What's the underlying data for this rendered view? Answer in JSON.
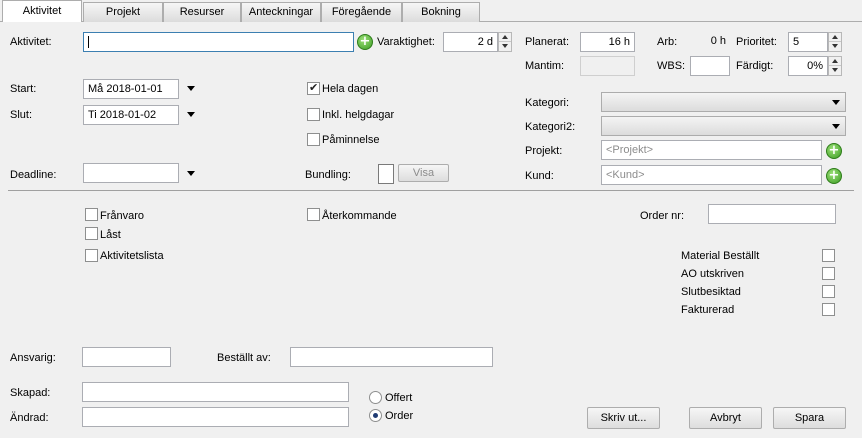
{
  "tabs": [
    "Aktivitet",
    "Projekt",
    "Resurser",
    "Anteckningar",
    "Föregående",
    "Bokning"
  ],
  "labels": {
    "aktivitet": "Aktivitet:",
    "varaktighet": "Varaktighet:",
    "planerat": "Planerat:",
    "arb": "Arb:",
    "prioritet": "Prioritet:",
    "mantim": "Mantim:",
    "wbs": "WBS:",
    "fardigt": "Färdigt:",
    "start": "Start:",
    "slut": "Slut:",
    "deadline": "Deadline:",
    "bundling": "Bundling:",
    "kategori": "Kategori:",
    "kategori2": "Kategori2:",
    "projekt": "Projekt:",
    "kund": "Kund:",
    "order_nr": "Order nr:",
    "ansvarig": "Ansvarig:",
    "bestallt_av": "Beställt av:",
    "skapad": "Skapad:",
    "andrad": "Ändrad:"
  },
  "values": {
    "aktivitet": "",
    "varaktighet": "2 d",
    "planerat": "16 h",
    "arb": "0 h",
    "prioritet": "5",
    "mantim": "",
    "wbs": "",
    "fardigt": "0%",
    "start": "Må 2018-01-01",
    "slut": "Ti 2018-01-02",
    "deadline": "",
    "order_nr": "",
    "ansvarig": "",
    "bestallt_av": "",
    "skapad": "",
    "andrad": ""
  },
  "placeholders": {
    "projekt": "<Projekt>",
    "kund": "<Kund>"
  },
  "checkboxes": {
    "hela_dagen": "Hela dagen",
    "inkl_helgdagar": "Inkl. helgdagar",
    "paminnelse": "Påminnelse",
    "aterkommande": "Återkommande",
    "franvaro": "Frånvaro",
    "last": "Låst",
    "aktivitetslista": "Aktivitetslista",
    "material_bestallt": "Material Beställt",
    "ao_utskriven": "AO utskriven",
    "slutbesiktad": "Slutbesiktad",
    "fakturerad": "Fakturerad"
  },
  "radios": {
    "offert": "Offert",
    "order": "Order"
  },
  "buttons": {
    "visa": "Visa",
    "skriv_ut": "Skriv ut...",
    "avbryt": "Avbryt",
    "spara": "Spara"
  },
  "icons": {
    "add": "+"
  }
}
